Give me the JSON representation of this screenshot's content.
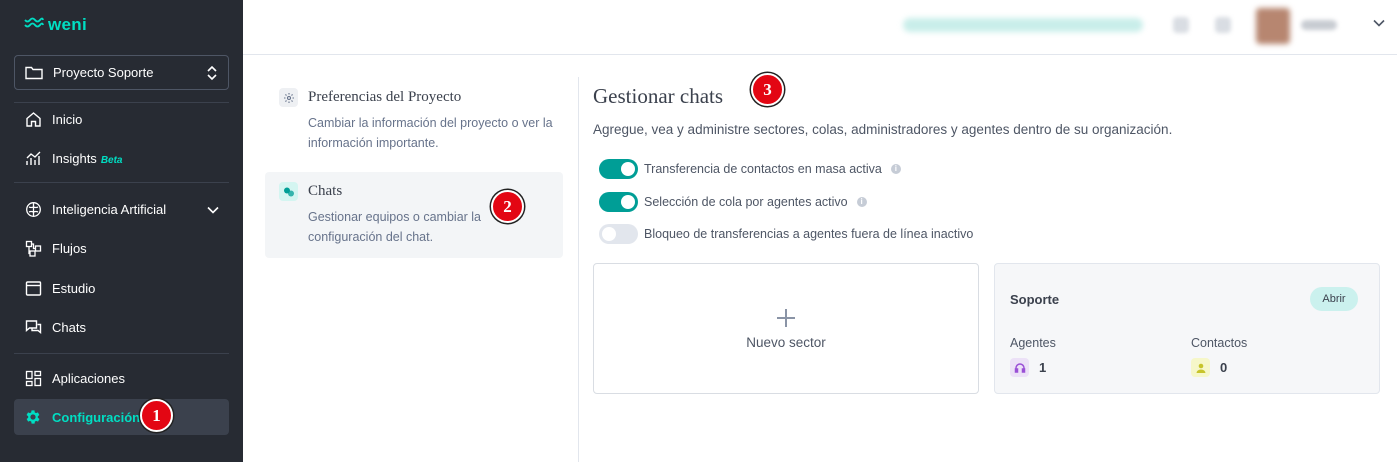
{
  "app": {
    "logo_text": "weni"
  },
  "sidebar": {
    "project": {
      "name": "Proyecto Soporte",
      "icon": "folder-icon"
    },
    "items": [
      {
        "label": "Inicio",
        "icon": "home-icon"
      },
      {
        "label": "Insights",
        "badge": "Beta",
        "icon": "chart-icon"
      },
      {
        "label": "Inteligencia Artificial",
        "icon": "brain-icon"
      },
      {
        "label": "Flujos",
        "icon": "flows-icon"
      },
      {
        "label": "Estudio",
        "icon": "window-icon"
      },
      {
        "label": "Chats",
        "icon": "chat-icon"
      },
      {
        "label": "Aplicaciones",
        "icon": "apps-icon"
      },
      {
        "label": "Configuración",
        "icon": "gear-icon",
        "active": true
      }
    ]
  },
  "settings_menu": [
    {
      "title": "Preferencias del Proyecto",
      "description": "Cambiar la información del proyecto o ver la información importante.",
      "icon": "gear-icon"
    },
    {
      "title": "Chats",
      "description": "Gestionar equipos o cambiar la configuración del chat.",
      "icon": "chat-bubbles-icon",
      "selected": true
    }
  ],
  "main": {
    "title": "Gestionar chats",
    "subtitle": "Agregue, vea y administre sectores, colas, administradores y agentes dentro de su organización.",
    "toggles": [
      {
        "label": "Transferencia de contactos en masa activa",
        "on": true
      },
      {
        "label": "Selección de cola por agentes activo",
        "on": true
      },
      {
        "label": "Bloqueo de transferencias a agentes fuera de línea inactivo",
        "on": false
      }
    ],
    "new_sector_label": "Nuevo sector",
    "sector": {
      "name": "Soporte",
      "open_label": "Abrir",
      "agents_label": "Agentes",
      "agents_count": "1",
      "contacts_label": "Contactos",
      "contacts_count": "0"
    }
  },
  "markers": [
    "1",
    "2",
    "3"
  ],
  "colors": {
    "sidebar_bg": "#272b33",
    "accent": "#00dec3",
    "toggle_on": "#009e96",
    "marker": "#e30613"
  }
}
